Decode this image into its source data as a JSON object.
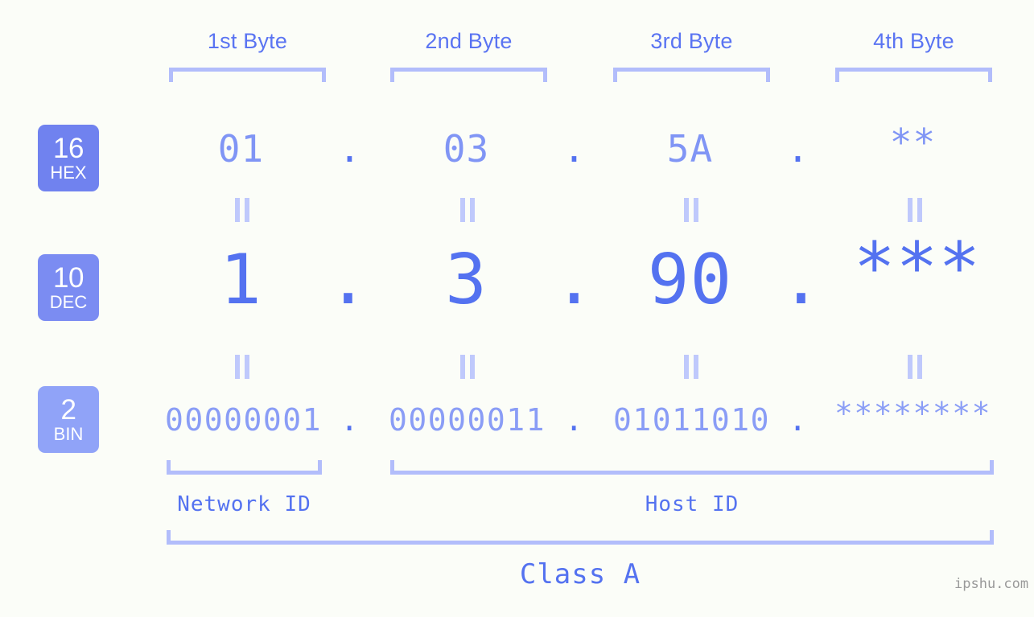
{
  "meta": {
    "background_color": "#fbfdf8",
    "accent_color": "#5472f0",
    "light_accent_color": "#b2bdfb"
  },
  "byte_headers": [
    {
      "label": "1st Byte"
    },
    {
      "label": "2nd Byte"
    },
    {
      "label": "3rd Byte"
    },
    {
      "label": "4th Byte"
    }
  ],
  "rows": [
    {
      "badge": {
        "number": "16",
        "abbr": "HEX",
        "color": "#7082ef"
      },
      "values": [
        "01",
        "03",
        "5A",
        "**"
      ],
      "separator": "."
    },
    {
      "badge": {
        "number": "10",
        "abbr": "DEC",
        "color": "#7b8cf2"
      },
      "values": [
        "1",
        "3",
        "90",
        "***"
      ],
      "separator": "."
    },
    {
      "badge": {
        "number": "2",
        "abbr": "BIN",
        "color": "#90a3f8"
      },
      "values": [
        "00000001",
        "00000011",
        "01011010",
        "********"
      ],
      "separator": "."
    }
  ],
  "equality_marks": {
    "symbol": "=",
    "count_per_row": 4,
    "rows": 2
  },
  "sections": [
    {
      "name": "network-id",
      "label": "Network ID"
    },
    {
      "name": "host-id",
      "label": "Host ID"
    }
  ],
  "class_label": "Class A",
  "watermark": "ipshu.com"
}
